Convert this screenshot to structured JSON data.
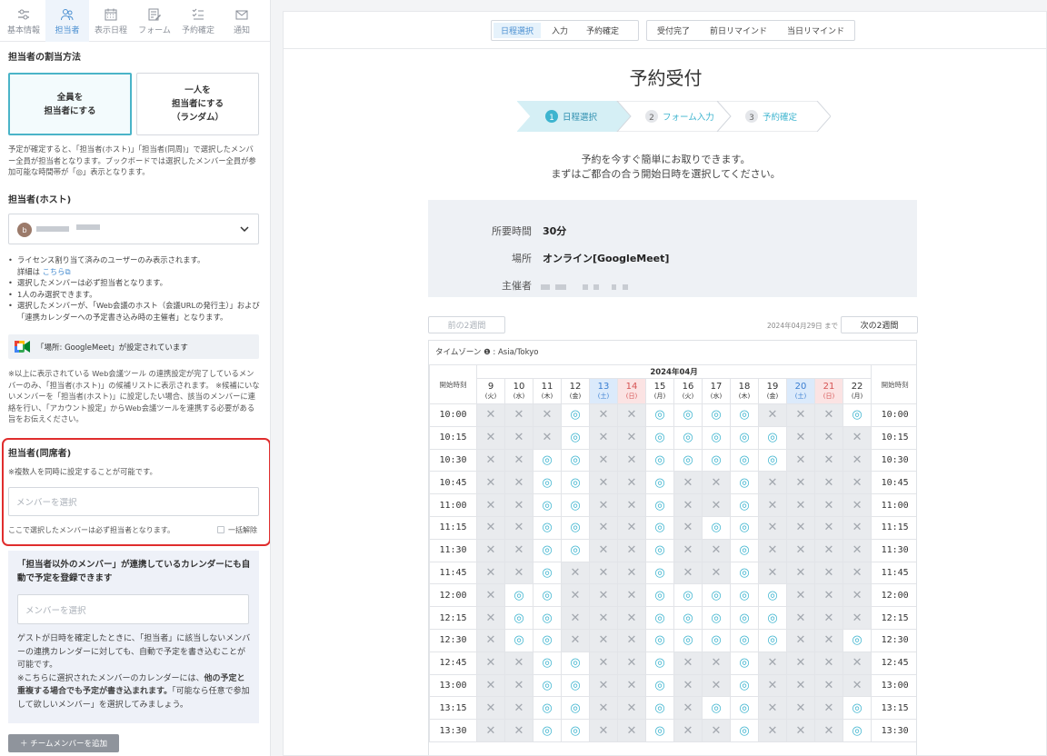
{
  "nav": [
    {
      "label": "基本情報",
      "icon": "sliders-icon",
      "active": false
    },
    {
      "label": "担当者",
      "icon": "users-icon",
      "active": true
    },
    {
      "label": "表示日程",
      "icon": "calendar-icon",
      "active": false
    },
    {
      "label": "フォーム",
      "icon": "form-edit-icon",
      "active": false
    },
    {
      "label": "予約確定",
      "icon": "checklist-icon",
      "active": false
    },
    {
      "label": "通知",
      "icon": "mail-icon",
      "active": false
    }
  ],
  "assign": {
    "title": "担当者の割当方法",
    "opt_all": "全員を\n担当者にする",
    "opt_one": "一人を\n担当者にする\n（ランダム）",
    "desc": "予定が確定すると、「担当者(ホスト)」「担当者(同周)」で選択したメンバー全員が担当者となります。ブックボードでは選択したメンバー全員が参加可能な時間帯が「◎」表示となります。"
  },
  "host": {
    "title": "担当者(ホスト)",
    "avatar_initial": "b",
    "bullet1_a": "ライセンス割り当て済みのユーザーのみ表示されます。",
    "bullet1_b": "詳細は",
    "bullet1_link": "こちら",
    "bullet2": "選択したメンバーは必ず担当者となります。",
    "bullet3": "1人のみ選択できます。",
    "bullet4": "選択したメンバーが、「Web会議のホスト（会議URLの発行主）」および「連携カレンダーへの予定書き込み時の主催者」となります。",
    "meet_note": "「場所: GoogleMeet」が設定されています",
    "warn": "※以上に表示されている Web会議ツール の連携設定が完了しているメンバーのみ、「担当者(ホスト)」の候補リストに表示されます。 ※候補にいないメンバーを「担当者(ホスト)」に設定したい場合、該当のメンバーに連絡を行い、「アカウント設定」からWeb会議ツールを連携する必要がある旨をお伝えください。"
  },
  "attendee": {
    "title": "担当者(同席者)",
    "note": "※複数人を同時に設定することが可能です。",
    "placeholder": "メンバーを選択",
    "footnote": "ここで選択したメンバーは必ず担当者となります。",
    "clear_all": "一括解除"
  },
  "other": {
    "title": "「担当者以外のメンバー」が連携しているカレンダーにも自動で予定を登録できます",
    "placeholder": "メンバーを選択",
    "desc1": "ゲストが日時を確定したときに、「担当者」に該当しないメンバーの連携カレンダーに対しても、自動で予定を書き込むことが可能です。",
    "desc2_a": "※こちらに選択されたメンバーのカレンダーには、",
    "desc2_b": "他の予定と重複する場合でも予定が書き込まれます。",
    "desc2_c": "「可能なら任意で参加して欲しいメンバー」を選択してみましょう。",
    "add_button": "＋ チームメンバーを追加"
  },
  "tabs_a": [
    {
      "label": "日程選択",
      "active": true
    },
    {
      "label": "入力",
      "active": false
    },
    {
      "label": "予約確定",
      "active": false
    }
  ],
  "tabs_b": [
    {
      "label": "受付完了"
    },
    {
      "label": "前日リマインド"
    },
    {
      "label": "当日リマインド"
    }
  ],
  "preview": {
    "title": "予約受付",
    "steps": [
      {
        "num": "1",
        "label": "日程選択",
        "active": true
      },
      {
        "num": "2",
        "label": "フォーム入力",
        "active": false
      },
      {
        "num": "3",
        "label": "予約確定",
        "active": false
      }
    ],
    "intro": "予約を今すぐ簡単にお取りできます。\nまずはご都合の合う開始日時を選択してください。",
    "info": [
      {
        "label": "所要時間",
        "value": "30分"
      },
      {
        "label": "場所",
        "value": "オンライン[GoogleMeet]"
      },
      {
        "label": "主催者",
        "value": ""
      }
    ],
    "prev_button": "前の2週間",
    "next_button": "次の2週間",
    "until": "2024年04月29日 まで",
    "timezone": "タイムゾーン ❶ : Asia/Tokyo",
    "month": "2024年04月",
    "time_header": "開始時刻",
    "days": [
      {
        "d": "9",
        "w": "(火)",
        "t": ""
      },
      {
        "d": "10",
        "w": "(水)",
        "t": ""
      },
      {
        "d": "11",
        "w": "(木)",
        "t": ""
      },
      {
        "d": "12",
        "w": "(金)",
        "t": ""
      },
      {
        "d": "13",
        "w": "(土)",
        "t": "sat"
      },
      {
        "d": "14",
        "w": "(日)",
        "t": "sun"
      },
      {
        "d": "15",
        "w": "(月)",
        "t": ""
      },
      {
        "d": "16",
        "w": "(火)",
        "t": ""
      },
      {
        "d": "17",
        "w": "(水)",
        "t": ""
      },
      {
        "d": "18",
        "w": "(木)",
        "t": ""
      },
      {
        "d": "19",
        "w": "(金)",
        "t": ""
      },
      {
        "d": "20",
        "w": "(土)",
        "t": "sat"
      },
      {
        "d": "21",
        "w": "(日)",
        "t": "sun"
      },
      {
        "d": "22",
        "w": "(月)",
        "t": ""
      }
    ],
    "rows": [
      {
        "time": "10:00",
        "s": "xxxoxxooooxxxo"
      },
      {
        "time": "10:15",
        "s": "xxxoxxoooooxxx"
      },
      {
        "time": "10:30",
        "s": "xxooxxoooooxxx"
      },
      {
        "time": "10:45",
        "s": "xxooxxoxxoxxxx"
      },
      {
        "time": "11:00",
        "s": "xxooxxoxxoxxxx"
      },
      {
        "time": "11:15",
        "s": "xxooxxoxooxxxx"
      },
      {
        "time": "11:30",
        "s": "xxooxxoxxoxxxx"
      },
      {
        "time": "11:45",
        "s": "xxoxxxoxxoxxxx"
      },
      {
        "time": "12:00",
        "s": "xooxxxoooooxxx"
      },
      {
        "time": "12:15",
        "s": "xooxxxoooooxxx"
      },
      {
        "time": "12:30",
        "s": "xooxxxoooooxxo"
      },
      {
        "time": "12:45",
        "s": "xxooxxoxxoxxxx"
      },
      {
        "time": "13:00",
        "s": "xxooxxoxxoxxxx"
      },
      {
        "time": "13:15",
        "s": "xxooxxoxooxxxo"
      },
      {
        "time": "13:30",
        "s": "xxooxxoxxoxxxo"
      }
    ]
  }
}
